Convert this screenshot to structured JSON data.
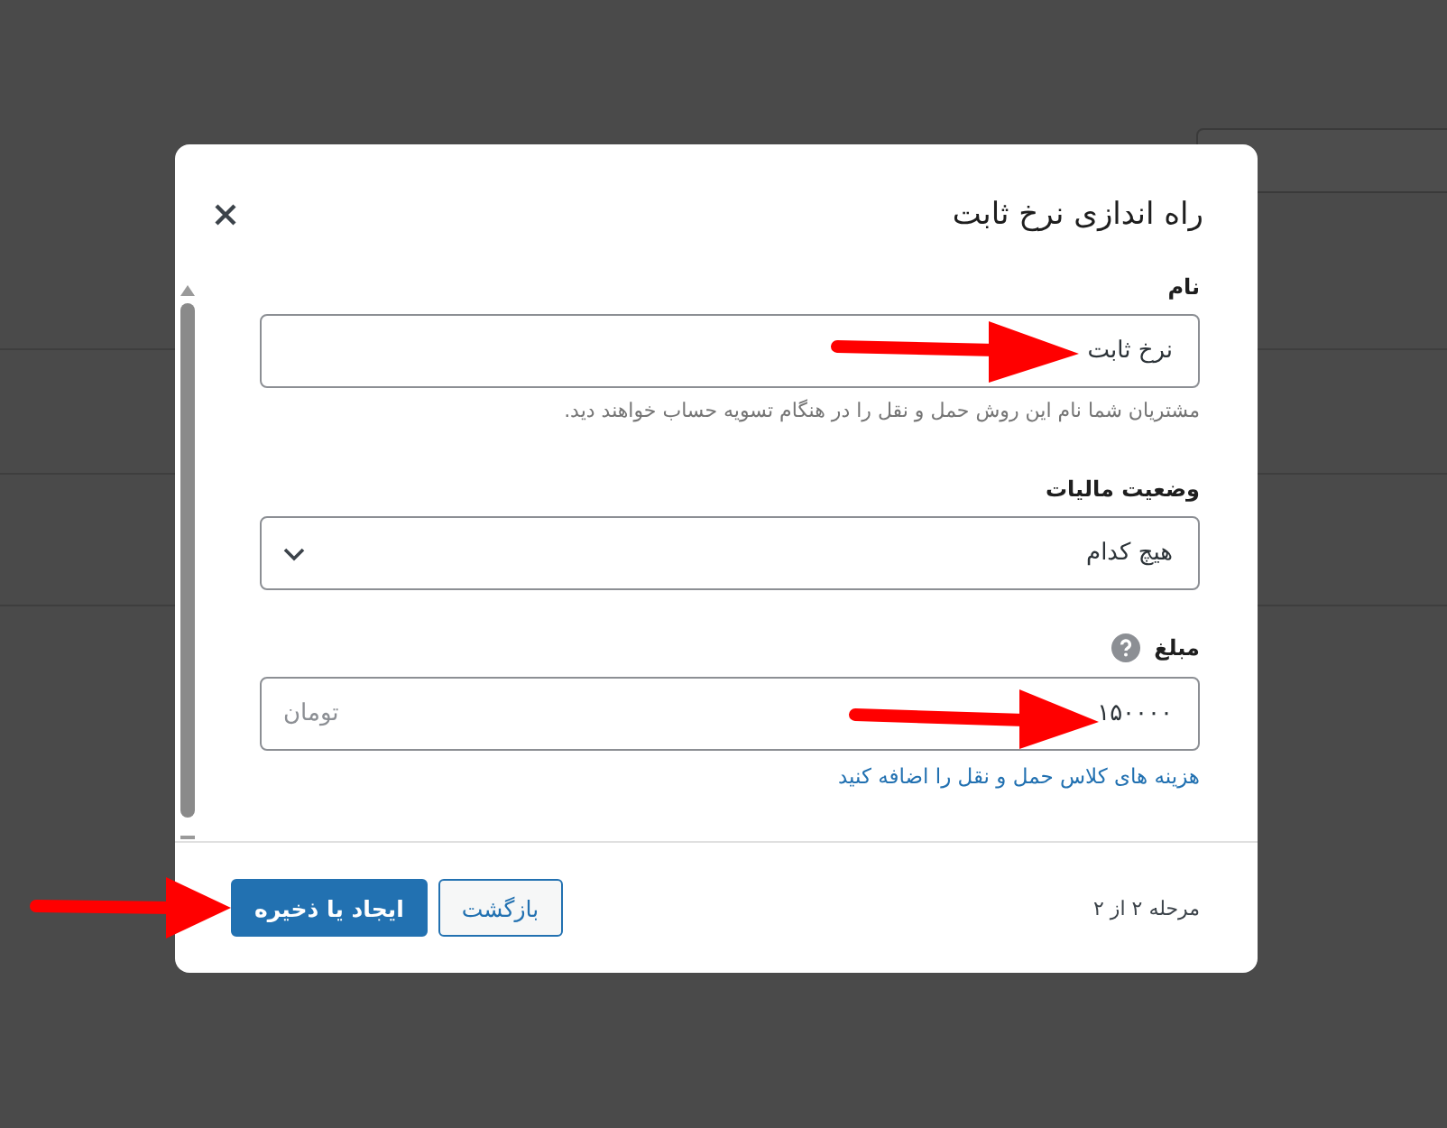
{
  "dialog": {
    "title": "راه اندازی نرخ ثابت",
    "fields": [
      {
        "kind": "text",
        "label": "نام",
        "value": "نرخ ثابت",
        "help": "مشتریان شما نام این روش حمل و نقل را در هنگام تسویه حساب خواهند دید."
      },
      {
        "kind": "select",
        "label": "وضعیت مالیات",
        "value": "هیچ کدام"
      },
      {
        "kind": "amount",
        "label": "مبلغ",
        "value": "۱۵۰۰۰۰",
        "suffix": "تومان",
        "link": "هزینه های کلاس حمل و نقل را اضافه کنید"
      }
    ],
    "footer": {
      "step": "مرحله ۲ از ۲",
      "buttons": [
        {
          "kind": "secondary",
          "label": "بازگشت"
        },
        {
          "kind": "primary",
          "label": "ایجاد یا ذخیره"
        }
      ]
    }
  }
}
